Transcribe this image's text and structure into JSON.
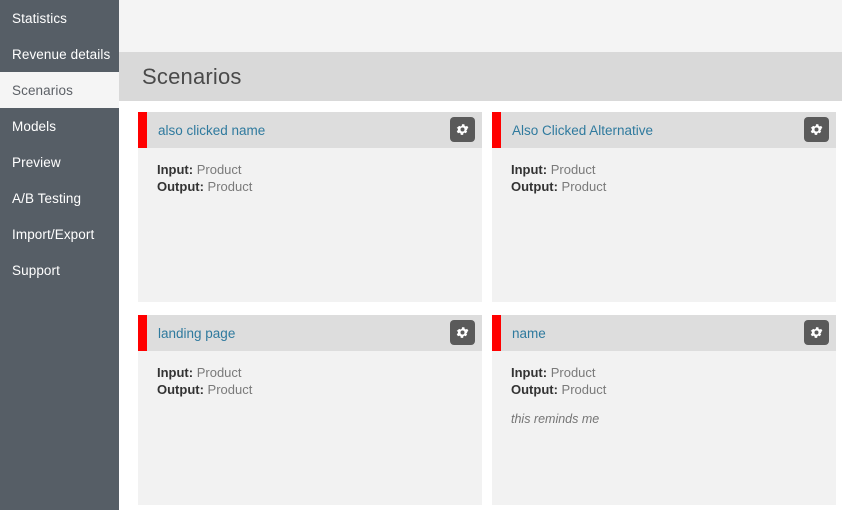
{
  "sidebar": {
    "items": [
      {
        "label": "Statistics",
        "active": false
      },
      {
        "label": "Revenue details",
        "active": false
      },
      {
        "label": "Scenarios",
        "active": true
      },
      {
        "label": "Models",
        "active": false
      },
      {
        "label": "Preview",
        "active": false
      },
      {
        "label": "A/B Testing",
        "active": false
      },
      {
        "label": "Import/Export",
        "active": false
      },
      {
        "label": "Support",
        "active": false
      }
    ]
  },
  "header": {
    "title": "Scenarios"
  },
  "labels": {
    "input": "Input:",
    "output": "Output:",
    "settings_icon": "gear-icon"
  },
  "colors": {
    "sidebar_bg": "#565e66",
    "header_bar": "#d9d9d9",
    "card_accent": "#ff0000",
    "card_head": "#dddddd",
    "card_body": "#f2f2f2",
    "link": "#2f7a9e"
  },
  "cards": [
    {
      "title": "also clicked name",
      "input": "Product",
      "output": "Product",
      "note": ""
    },
    {
      "title": "Also Clicked Alternative",
      "input": "Product",
      "output": "Product",
      "note": ""
    },
    {
      "title": "landing page",
      "input": "Product",
      "output": "Product",
      "note": ""
    },
    {
      "title": "name",
      "input": "Product",
      "output": "Product",
      "note": "this reminds me"
    }
  ]
}
